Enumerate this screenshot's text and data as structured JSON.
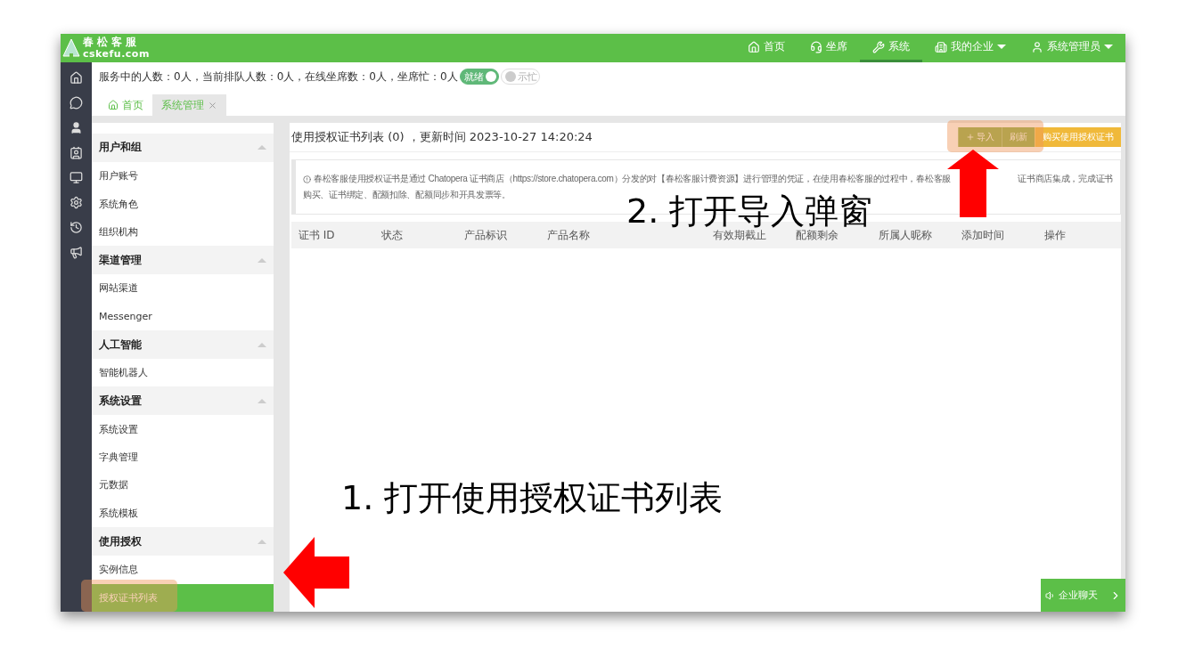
{
  "logo": {
    "name": "春松客服",
    "domain": "cskefu.com"
  },
  "nav": [
    {
      "label": "首页",
      "selected": false,
      "dropdown": false
    },
    {
      "label": "坐席",
      "selected": false,
      "dropdown": false
    },
    {
      "label": "系统",
      "selected": true,
      "dropdown": false
    },
    {
      "label": "我的企业",
      "selected": false,
      "dropdown": true
    },
    {
      "label": "系统管理员",
      "selected": false,
      "dropdown": true
    }
  ],
  "status": {
    "text": "服务中的人数：0人，当前排队人数：0人，在线坐席数：0人，坐席忙：0人",
    "toggles": [
      {
        "label": "就绪",
        "on": true
      },
      {
        "label": "示忙",
        "on": false
      }
    ]
  },
  "tabs": [
    {
      "label": "首页",
      "selected": false,
      "closable": false
    },
    {
      "label": "系统管理",
      "selected": true,
      "closable": true
    }
  ],
  "menu": [
    {
      "title": "用户和组",
      "expanded": true,
      "items": [
        {
          "label": "用户账号",
          "selected": false
        },
        {
          "label": "系统角色",
          "selected": false
        },
        {
          "label": "组织机构",
          "selected": false
        }
      ]
    },
    {
      "title": "渠道管理",
      "expanded": true,
      "items": [
        {
          "label": "网站渠道",
          "selected": false
        },
        {
          "label": "Messenger",
          "selected": false
        }
      ]
    },
    {
      "title": "人工智能",
      "expanded": true,
      "items": [
        {
          "label": "智能机器人",
          "selected": false
        }
      ]
    },
    {
      "title": "系统设置",
      "expanded": true,
      "items": [
        {
          "label": "系统设置",
          "selected": false
        },
        {
          "label": "字典管理",
          "selected": false
        },
        {
          "label": "元数据",
          "selected": false
        },
        {
          "label": "系统模板",
          "selected": false
        }
      ]
    },
    {
      "title": "使用授权",
      "expanded": true,
      "items": [
        {
          "label": "实例信息",
          "selected": false
        },
        {
          "label": "授权证书列表",
          "selected": true
        }
      ]
    }
  ],
  "panel": {
    "title": "使用授权证书列表 (0) ，更新时间 2023-10-27 14:20:24",
    "buttons": [
      {
        "label": "导入",
        "kind": "primary"
      },
      {
        "label": "刷新",
        "kind": "primary"
      },
      {
        "label": "购买使用授权证书",
        "kind": "warn"
      }
    ],
    "notice": {
      "line_1": [
        "春松客服使用授权证书是通过 Chatopera 证书商店（https://store.chatopera.com）分发的对【春松客服计费资源】进行管理的凭证，在使用春松客服的过程中，春松客服",
        "证书商店集成，完成证书"
      ],
      "line_2": "购买、证书绑定、配额扣除、配额同步和开具发票等。"
    },
    "columns": [
      "证书 ID",
      "状态",
      "产品标识",
      "产品名称",
      "有效期截止",
      "配额剩余",
      "所属人昵称",
      "添加时间",
      "操作"
    ]
  },
  "chat_button": "企业聊天",
  "annotations": [
    {
      "text": "1. 打开使用授权证书列表"
    },
    {
      "text": "2. 打开导入弹窗"
    }
  ]
}
